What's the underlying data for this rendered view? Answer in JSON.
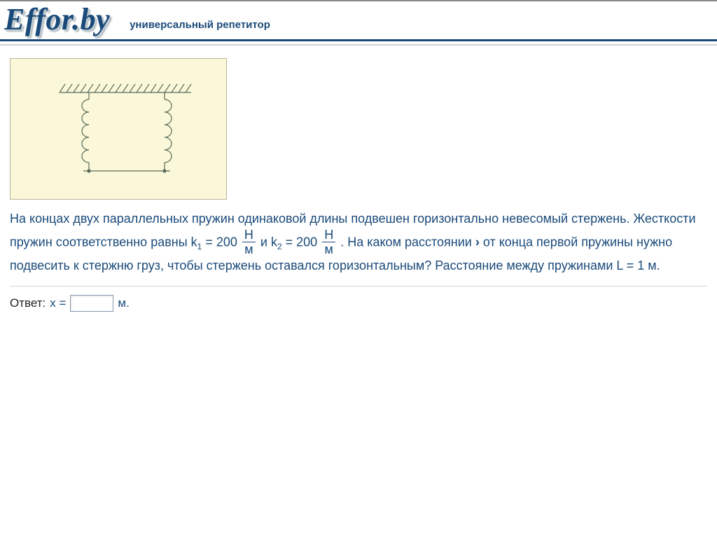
{
  "header": {
    "logo": "Effor.by",
    "tagline": "универсальный репетитор"
  },
  "problem": {
    "p1a": "На концах двух параллельных пружин одинаковой длины подвешен горизонтально невесомый стержень. Жесткости пружин соответственно равны k",
    "k1_sub": "1",
    "eq1": " = 200 ",
    "frac_num": "Н",
    "frac_den": "м",
    "and": " и k",
    "k2_sub": "2",
    "eq2": " = 200 ",
    "p1b": " . На каком расстоянии ",
    "p2": "от конца первой пружины нужно подвесить к стержню груз, чтобы стержень оставался горизонтальным? Расстояние между пружинами L = 1 м."
  },
  "answer": {
    "label": "Ответ:",
    "var": "x =",
    "unit": "м."
  }
}
